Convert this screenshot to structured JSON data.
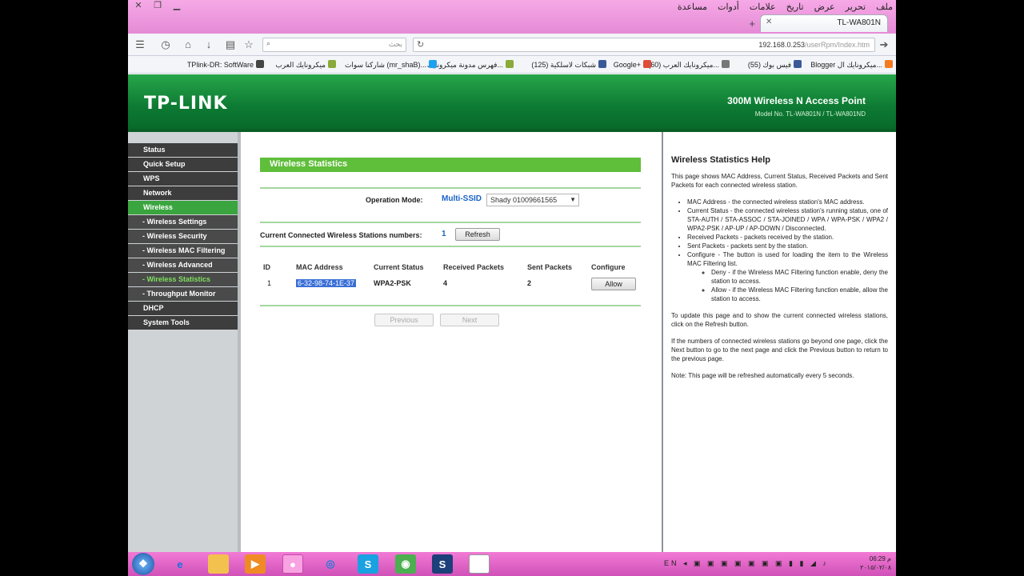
{
  "browser": {
    "menu": [
      "ملف",
      "تحرير",
      "عرض",
      "تاريخ",
      "علامات",
      "أدوات",
      "مساعدة"
    ],
    "tab_title": "TL-WA801N",
    "new_tab": "+",
    "search_placeholder": "بحث",
    "url_host": "192.168.0.253",
    "url_path": "/userRpm/Index.htm",
    "bookmarks": [
      {
        "label": "Blogger ميكرونايك ال...",
        "color": "#f47b20"
      },
      {
        "label": "فيس بوك (55)",
        "color": "#3b5998"
      },
      {
        "label": "ميكرونايك العرب (60)...",
        "color": "#777777"
      },
      {
        "label": "Google+",
        "color": "#dd4b39"
      },
      {
        "label": "شبكات لاسلكية (125)",
        "color": "#3b5998"
      },
      {
        "label": "فهرس مدونة ميكرونايك...",
        "color": "#8aaa3a"
      },
      {
        "label": "شاركنا سوات (mr_shaB)...",
        "color": "#1da1f2"
      },
      {
        "label": "ميكرونايك العرب",
        "color": "#8aaa3a"
      },
      {
        "label": "TPlink-DR: SoftWare",
        "color": "#444444"
      }
    ]
  },
  "header": {
    "logo": "TP-LINK",
    "product": "300M Wireless N Access Point",
    "model": "Model No. TL-WA801N / TL-WA801ND"
  },
  "sidebar": {
    "items": [
      {
        "label": "Status"
      },
      {
        "label": "Quick Setup"
      },
      {
        "label": "WPS"
      },
      {
        "label": "Network"
      },
      {
        "label": "Wireless"
      },
      {
        "label": "- Wireless Settings"
      },
      {
        "label": "- Wireless Security"
      },
      {
        "label": "- Wireless MAC Filtering"
      },
      {
        "label": "- Wireless Advanced"
      },
      {
        "label": "- Wireless Statistics"
      },
      {
        "label": "- Throughput Monitor"
      },
      {
        "label": "DHCP"
      },
      {
        "label": "System Tools"
      }
    ]
  },
  "content": {
    "title": "Wireless Statistics",
    "operation_mode_label": "Operation Mode:",
    "operation_mode_value": "Multi-SSID",
    "ssid_selected": "Shady 01009661565",
    "stations_label": "Current Connected Wireless Stations numbers:",
    "stations_count": "1",
    "refresh_label": "Refresh",
    "table": {
      "headers": [
        "ID",
        "MAC Address",
        "Current Status",
        "Received Packets",
        "Sent Packets",
        "Configure"
      ],
      "rows": [
        {
          "id": "1",
          "mac": "6-32-98-74-1E-37",
          "status": "WPA2-PSK",
          "received": "4",
          "sent": "2",
          "action": "Allow"
        }
      ]
    },
    "previous_label": "Previous",
    "next_label": "Next"
  },
  "help": {
    "title": "Wireless Statistics Help",
    "intro": "This page shows MAC Address, Current Status, Received Packets and Sent Packets for each connected wireless station.",
    "items": [
      "MAC Address - the connected wireless station's MAC address.",
      "Current Status - the connected wireless station's running status, one of STA-AUTH / STA-ASSOC / STA-JOINED / WPA / WPA-PSK / WPA2 / WPA2-PSK / AP-UP / AP-DOWN / Disconnected.",
      "Received Packets - packets received by the station.",
      "Sent Packets - packets sent by the station.",
      "Configure - The button is used for loading the item to the Wireless MAC Filtering list."
    ],
    "subitems": [
      "Deny - if the Wireless MAC Filtering function enable, deny the station to access.",
      "Allow - if the Wireless MAC Filtering function enable, allow the station to access."
    ],
    "p_update": "To update this page and to show the current connected wireless stations, click on the Refresh button.",
    "p_next": "If the numbers of connected wireless stations go beyond one page, click the Next button to go to the next page and click the Previous button to return to the previous page.",
    "note": "Note: This page will be refreshed automatically every 5 seconds."
  },
  "taskbar": {
    "lang": "EN",
    "time": "06:29 م",
    "date": "٢٠١٥/٠٢/٠٨"
  }
}
